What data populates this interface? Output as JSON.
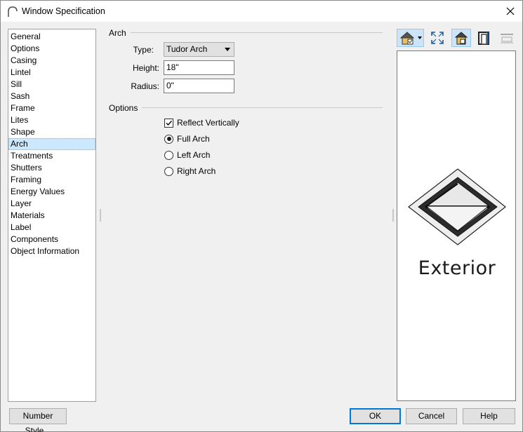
{
  "window": {
    "title": "Window Specification"
  },
  "nav": {
    "items": [
      "General",
      "Options",
      "Casing",
      "Lintel",
      "Sill",
      "Sash",
      "Frame",
      "Lites",
      "Shape",
      "Arch",
      "Treatments",
      "Shutters",
      "Framing",
      "Energy Values",
      "Layer",
      "Materials",
      "Label",
      "Components",
      "Object Information"
    ],
    "selected": "Arch"
  },
  "arch": {
    "group_label": "Arch",
    "type_label": "Type:",
    "type_value": "Tudor Arch",
    "height_label": "Height:",
    "height_value": "18\"",
    "radius_label": "Radius:",
    "radius_value": "0\""
  },
  "options": {
    "group_label": "Options",
    "reflect_vertically": {
      "label": "Reflect Vertically",
      "checked": true
    },
    "radios": [
      {
        "label": "Full Arch",
        "selected": true
      },
      {
        "label": "Left Arch",
        "selected": false
      },
      {
        "label": "Right Arch",
        "selected": false
      }
    ]
  },
  "toolbar": {
    "icons": [
      "view-mode-icon",
      "fill-window-icon",
      "camera-view-icon",
      "window-elevation-icon",
      "plan-view-icon"
    ]
  },
  "preview": {
    "label": "Exterior"
  },
  "footer": {
    "number_style": "Number Style...",
    "ok": "OK",
    "cancel": "Cancel",
    "help": "Help"
  },
  "colors": {
    "accent": "#0078d7",
    "selection": "#cce8ff"
  }
}
